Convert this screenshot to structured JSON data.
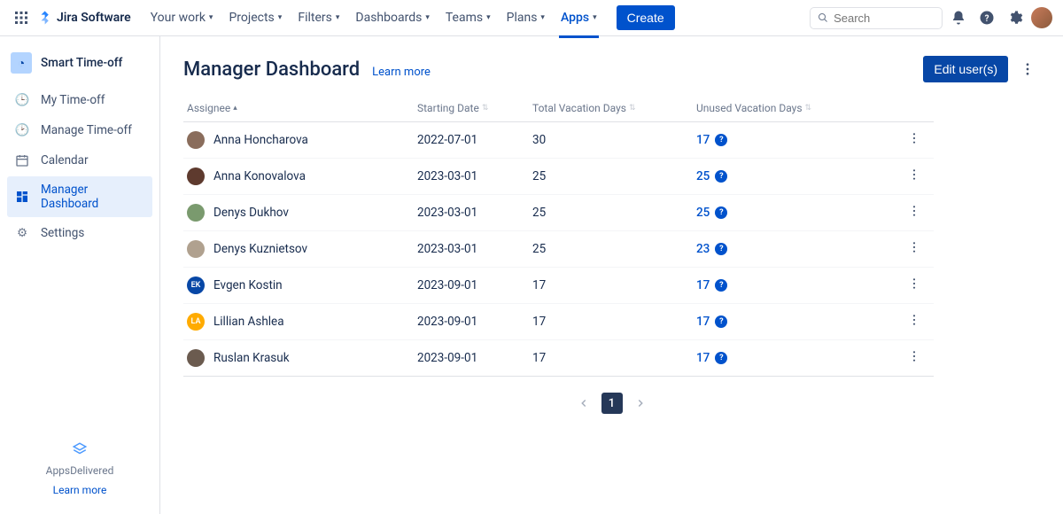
{
  "topnav": {
    "product": "Jira Software",
    "menu": [
      {
        "label": "Your work",
        "active": false
      },
      {
        "label": "Projects",
        "active": false
      },
      {
        "label": "Filters",
        "active": false
      },
      {
        "label": "Dashboards",
        "active": false
      },
      {
        "label": "Teams",
        "active": false
      },
      {
        "label": "Plans",
        "active": false
      },
      {
        "label": "Apps",
        "active": true
      }
    ],
    "create_label": "Create",
    "search_placeholder": "Search"
  },
  "sidebar": {
    "app_name": "Smart Time-off",
    "items": [
      {
        "label": "My Time-off",
        "icon": "clock-user-icon",
        "active": false
      },
      {
        "label": "Manage Time-off",
        "icon": "clock-manage-icon",
        "active": false
      },
      {
        "label": "Calendar",
        "icon": "calendar-icon",
        "active": false
      },
      {
        "label": "Manager Dashboard",
        "icon": "dashboard-icon",
        "active": true
      },
      {
        "label": "Settings",
        "icon": "gear-icon",
        "active": false
      }
    ],
    "footer_brand": "AppsDelivered",
    "footer_link": "Learn more"
  },
  "page": {
    "title": "Manager Dashboard",
    "learn_more": "Learn more",
    "edit_users_label": "Edit user(s)"
  },
  "table": {
    "columns": {
      "assignee": "Assignee",
      "start": "Starting Date",
      "total": "Total Vacation Days",
      "unused": "Unused Vacation Days"
    },
    "rows": [
      {
        "name": "Anna Honcharova",
        "start": "2022-07-01",
        "total": "30",
        "unused": "17",
        "avatar_bg": "#8a6d5c",
        "avatar_text": ""
      },
      {
        "name": "Anna Konovalova",
        "start": "2023-03-01",
        "total": "25",
        "unused": "25",
        "avatar_bg": "#5e3a2e",
        "avatar_text": ""
      },
      {
        "name": "Denys Dukhov",
        "start": "2023-03-01",
        "total": "25",
        "unused": "25",
        "avatar_bg": "#7a9a6e",
        "avatar_text": ""
      },
      {
        "name": "Denys Kuznietsov",
        "start": "2023-03-01",
        "total": "25",
        "unused": "23",
        "avatar_bg": "#b0a18f",
        "avatar_text": ""
      },
      {
        "name": "Evgen Kostin",
        "start": "2023-09-01",
        "total": "17",
        "unused": "17",
        "avatar_bg": "#0747A6",
        "avatar_text": "EK"
      },
      {
        "name": "Lillian Ashlea",
        "start": "2023-09-01",
        "total": "17",
        "unused": "17",
        "avatar_bg": "#FFAB00",
        "avatar_text": "LA"
      },
      {
        "name": "Ruslan Krasuk",
        "start": "2023-09-01",
        "total": "17",
        "unused": "17",
        "avatar_bg": "#6b5b4f",
        "avatar_text": ""
      }
    ]
  },
  "pagination": {
    "current": "1"
  }
}
